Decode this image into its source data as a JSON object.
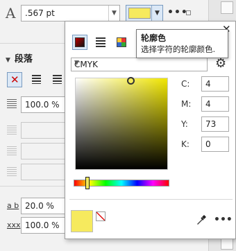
{
  "outline": {
    "width_value": ".567 pt",
    "color_hex": "#f6ea5e"
  },
  "paragraph": {
    "header": "段落",
    "indent_first": "100.0 %",
    "char_spacing": "20.0 %",
    "word_spacing": "100.0 %",
    "char_spacing_label": "a b",
    "word_spacing_label": "xxx"
  },
  "popup": {
    "color_model": "CMYK",
    "cmyk": [
      {
        "label": "C:",
        "value": "4"
      },
      {
        "label": "M:",
        "value": "4"
      },
      {
        "label": "Y:",
        "value": "73"
      },
      {
        "label": "K:",
        "value": "0"
      }
    ],
    "current_color_hex": "#f6ea5e"
  },
  "tooltip": {
    "title": "轮廓色",
    "description": "选择字符的轮廓颜色."
  },
  "icons": {
    "close": "close-icon",
    "gear": "gear-icon",
    "eyedropper": "eyedropper-icon",
    "more": "more-icon"
  }
}
